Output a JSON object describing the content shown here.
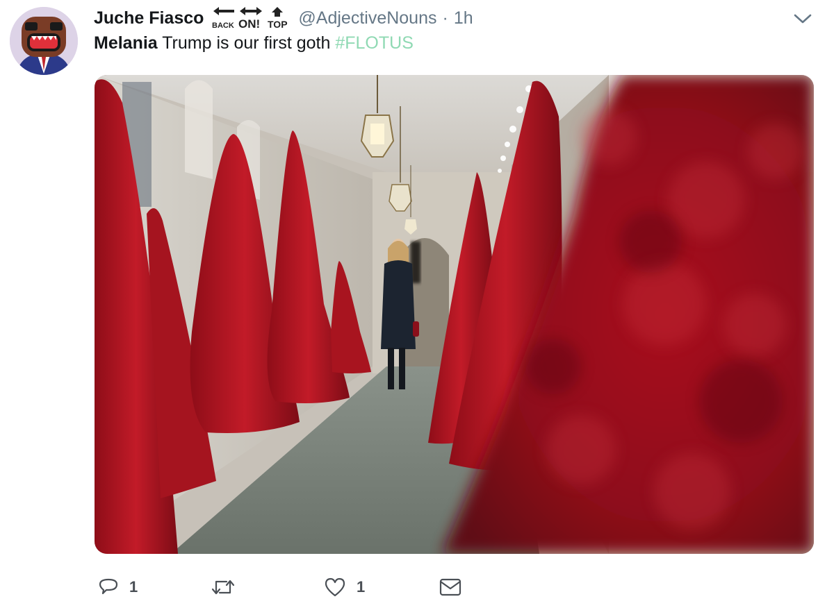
{
  "tweet": {
    "author": {
      "display_name": "Juche Fiasco",
      "handle": "@AdjectiveNouns",
      "avatar_icon": "cartoon-avatar-icon",
      "badge_text": [
        "BACK",
        "ON!",
        "TOP"
      ]
    },
    "separator": "·",
    "timestamp": "1h",
    "text": {
      "bold": "Melania",
      "plain": " Trump is our first goth ",
      "hashtag": "#FLOTUS"
    },
    "media": {
      "description_icon": "photo-hallway-red-trees"
    },
    "actions": {
      "reply": {
        "icon": "reply-icon",
        "count": "1"
      },
      "retweet": {
        "icon": "retweet-icon",
        "count": ""
      },
      "like": {
        "icon": "heart-icon",
        "count": "1"
      },
      "dm": {
        "icon": "envelope-icon"
      }
    },
    "menu_icon": "chevron-down-icon",
    "colors": {
      "hashtag": "#8fd9b3",
      "secondary_text": "#657786",
      "tree_red": "#b31c2a"
    }
  }
}
